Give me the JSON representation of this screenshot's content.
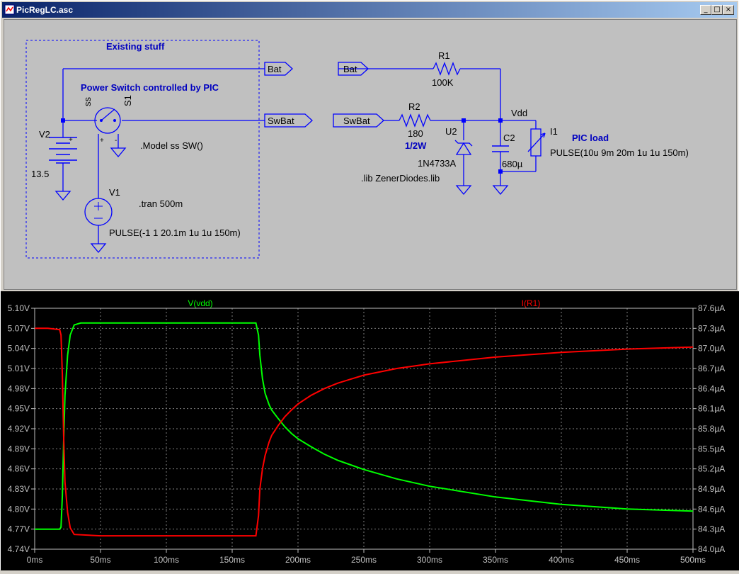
{
  "window": {
    "title": "PicRegLC.asc",
    "controls": {
      "minimize": "_",
      "maximize": "□",
      "close": "×"
    }
  },
  "schematic": {
    "box_label": "Existing stuff",
    "switch_label": "Power Switch controlled by PIC",
    "battery": {
      "name": "V2",
      "value": "13.5"
    },
    "switch": {
      "name": "S1",
      "model": "ss",
      "model_directive": ".Model ss SW()"
    },
    "v1": {
      "name": "V1",
      "value": "PULSE(-1 1 20.1m 1u 1u 150m)"
    },
    "tran": ".tran 500m",
    "net_labels": {
      "bat_out": "Bat",
      "swbat_out": "SwBat",
      "bat_in": "Bat",
      "swbat_in": "SwBat"
    },
    "r1": {
      "name": "R1",
      "value": "100K"
    },
    "r2": {
      "name": "R2",
      "value": "180",
      "power": "1/2W"
    },
    "u2": {
      "name": "U2",
      "value": "1N4733A",
      "lib": ".lib ZenerDiodes.lib"
    },
    "c2": {
      "name": "C2",
      "value": "680µ"
    },
    "vdd": "Vdd",
    "i1": {
      "name": "I1",
      "label": "PIC load",
      "value": "PULSE(10u 9m 20m 1u 1u 150m)"
    },
    "colors": {
      "wire": "#0000ff",
      "text": "#000000",
      "annotation": "#0000c0",
      "background": "#c0c0c0"
    },
    "symbols": {
      "plus": "+",
      "minus": "-",
      "minus_v1": "−"
    }
  },
  "chart_data": {
    "type": "line",
    "x_ticks": [
      "0ms",
      "50ms",
      "100ms",
      "150ms",
      "200ms",
      "250ms",
      "300ms",
      "350ms",
      "400ms",
      "450ms",
      "500ms"
    ],
    "y_left_ticks": [
      "5.10V",
      "5.07V",
      "5.04V",
      "5.01V",
      "4.98V",
      "4.95V",
      "4.92V",
      "4.89V",
      "4.86V",
      "4.83V",
      "4.80V",
      "4.77V",
      "4.74V"
    ],
    "y_right_ticks": [
      "87.6µA",
      "87.3µA",
      "87.0µA",
      "86.7µA",
      "86.4µA",
      "86.1µA",
      "85.8µA",
      "85.5µA",
      "85.2µA",
      "84.9µA",
      "84.6µA",
      "84.3µA",
      "84.0µA"
    ],
    "xlim": [
      0,
      500
    ],
    "ylim_left": [
      4.74,
      5.1
    ],
    "ylim_right": [
      84.0,
      87.6
    ],
    "grid": true,
    "background": "#000000",
    "series": [
      {
        "name": "V(vdd)",
        "axis": "left",
        "color": "#00ff00",
        "x": [
          0,
          10,
          19,
          20,
          21,
          22,
          23,
          25,
          27,
          30,
          35,
          50,
          100,
          150,
          168,
          170,
          171,
          173,
          175,
          178,
          180,
          185,
          190,
          195,
          200,
          210,
          220,
          230,
          240,
          250,
          275,
          300,
          350,
          400,
          450,
          500
        ],
        "y": [
          4.77,
          4.77,
          4.77,
          4.773,
          4.82,
          4.9,
          4.97,
          5.03,
          5.06,
          5.075,
          5.078,
          5.078,
          5.078,
          5.078,
          5.078,
          5.06,
          5.03,
          4.995,
          4.973,
          4.956,
          4.948,
          4.935,
          4.923,
          4.913,
          4.905,
          4.893,
          4.882,
          4.873,
          4.866,
          4.859,
          4.845,
          4.834,
          4.818,
          4.807,
          4.8,
          4.797
        ]
      },
      {
        "name": "I(R1)",
        "axis": "right",
        "color": "#ff0000",
        "x": [
          0,
          10,
          19,
          20,
          21,
          22,
          23,
          25,
          27,
          30,
          50,
          100,
          150,
          168,
          170,
          171,
          173,
          175,
          178,
          180,
          185,
          190,
          195,
          200,
          210,
          220,
          230,
          240,
          250,
          275,
          300,
          350,
          400,
          450,
          500
        ],
        "y": [
          87.3,
          87.3,
          87.28,
          87.2,
          86.6,
          85.7,
          85.0,
          84.55,
          84.32,
          84.22,
          84.2,
          84.2,
          84.2,
          84.2,
          84.5,
          84.9,
          85.2,
          85.4,
          85.6,
          85.7,
          85.85,
          85.98,
          86.08,
          86.17,
          86.3,
          86.4,
          86.48,
          86.54,
          86.6,
          86.7,
          86.77,
          86.87,
          86.94,
          86.99,
          87.02
        ]
      }
    ]
  }
}
